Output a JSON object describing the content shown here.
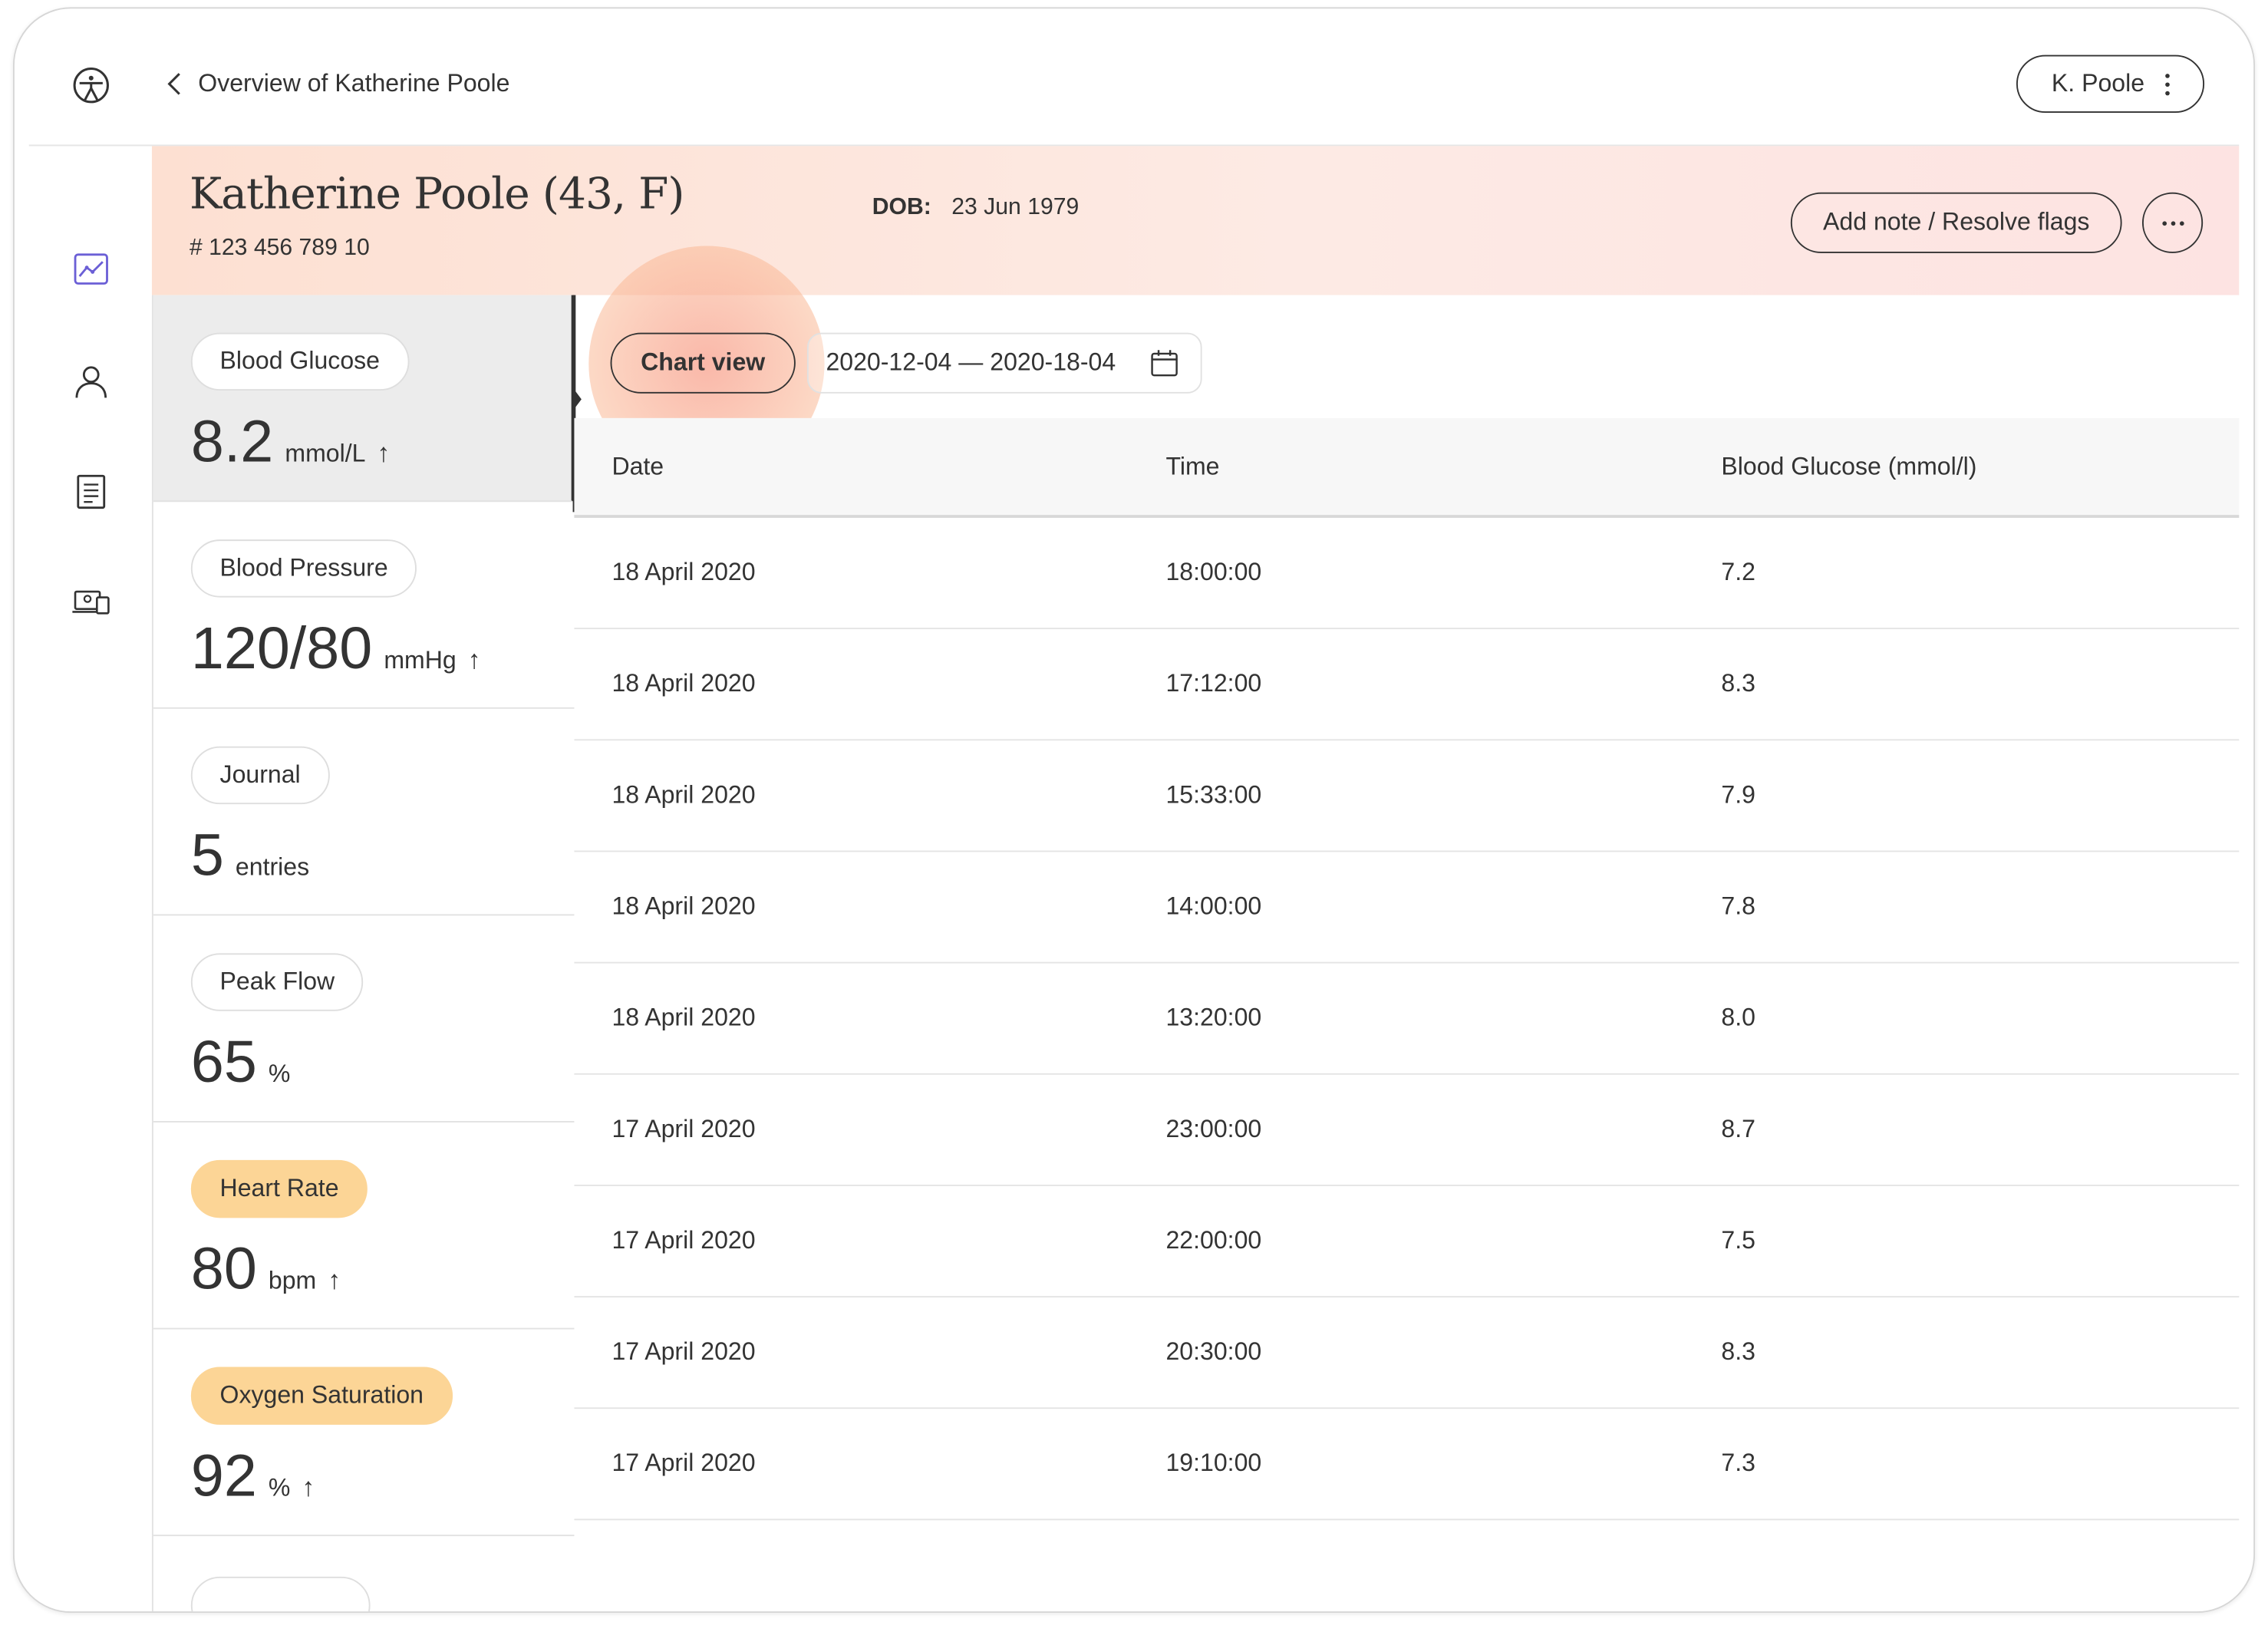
{
  "topbar": {
    "back_label": "Overview of Katherine Poole",
    "user_label": "K. Poole"
  },
  "patient": {
    "name": "Katherine Poole (43, F)",
    "id": "# 123 456 789 10",
    "dob_label": "DOB:",
    "dob_value": "23 Jun 1979"
  },
  "actions": {
    "add_note_label": "Add note / Resolve flags"
  },
  "metrics": [
    {
      "label": "Blood Glucose",
      "value": "8.2",
      "unit": "mmol/L",
      "arrow": "↑",
      "flag": false
    },
    {
      "label": "Blood Pressure",
      "value": "120/80",
      "unit": "mmHg",
      "arrow": "↑",
      "flag": false
    },
    {
      "label": "Journal",
      "value": "5",
      "unit": "entries",
      "arrow": "",
      "flag": false
    },
    {
      "label": "Peak Flow",
      "value": "65",
      "unit": "%",
      "arrow": "",
      "flag": false
    },
    {
      "label": "Heart Rate",
      "value": "80",
      "unit": "bpm",
      "arrow": "↑",
      "flag": true
    },
    {
      "label": "Oxygen Saturation",
      "value": "92",
      "unit": "%",
      "arrow": "↑",
      "flag": true
    }
  ],
  "toolbar": {
    "chart_view_label": "Chart view",
    "date_range": "2020-12-04 — 2020-18-04"
  },
  "table": {
    "headers": [
      "Date",
      "Time",
      "Blood Glucose (mmol/l)"
    ],
    "rows": [
      [
        "18 April 2020",
        "18:00:00",
        "7.2"
      ],
      [
        "18 April 2020",
        "17:12:00",
        "8.3"
      ],
      [
        "18 April 2020",
        "15:33:00",
        "7.9"
      ],
      [
        "18 April 2020",
        "14:00:00",
        "7.8"
      ],
      [
        "18 April 2020",
        "13:20:00",
        "8.0"
      ],
      [
        "17 April 2020",
        "23:00:00",
        "8.7"
      ],
      [
        "17 April 2020",
        "22:00:00",
        "7.5"
      ],
      [
        "17 April 2020",
        "20:30:00",
        "8.3"
      ],
      [
        "17 April 2020",
        "19:10:00",
        "7.3"
      ]
    ]
  },
  "colors": {
    "accent_nav": "#6b5fd6",
    "warning_pill": "#fcd596",
    "header_band": "#fde4da"
  }
}
